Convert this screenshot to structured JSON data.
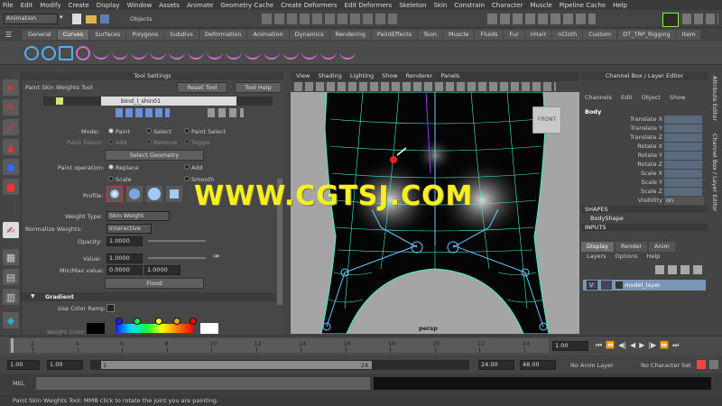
{
  "menu": [
    "File",
    "Edit",
    "Modify",
    "Create",
    "Display",
    "Window",
    "Assets",
    "Animate",
    "Geometry Cache",
    "Create Deformers",
    "Edit Deformers",
    "Skeleton",
    "Skin",
    "Constrain",
    "Character",
    "Muscle",
    "Pipeline Cache",
    "Help"
  ],
  "status_line": {
    "mode": "Animation",
    "objects_label": "Objects"
  },
  "shelf_tabs": [
    "General",
    "Curves",
    "Surfaces",
    "Polygons",
    "Subdivs",
    "Deformation",
    "Animation",
    "Dynamics",
    "Rendering",
    "PaintEffects",
    "Toon",
    "Muscle",
    "Fluids",
    "Fur",
    "nHair",
    "nCloth",
    "Custom",
    "DT_TRP_Rigging",
    "Item"
  ],
  "shelf_active_tab": "Curves",
  "tool_settings": {
    "title": "Tool Settings",
    "tool_name": "Paint Skin Weights Tool",
    "reset_label": "Reset Tool",
    "help_label": "Tool Help",
    "influence": "bind_l_shin01",
    "mode_label": "Mode:",
    "mode_options": [
      "Paint",
      "Select",
      "Paint Select"
    ],
    "paint_select_label": "Paint Select:",
    "paint_select_options": [
      "Add",
      "Remove",
      "Toggle"
    ],
    "select_geometry": "Select Geometry",
    "paint_operation_label": "Paint operation:",
    "paint_ops": [
      "Replace",
      "Add",
      "Scale",
      "Smooth"
    ],
    "profile_label": "Profile:",
    "weight_type_label": "Weight Type:",
    "weight_type": "Skin Weight",
    "normalize_label": "Normalize Weights:",
    "normalize": "Interactive",
    "opacity_label": "Opacity:",
    "opacity": "1.0000",
    "value_label": "Value:",
    "value": "1.0000",
    "minmax_label": "Min/Max value:",
    "min": "0.0000",
    "max": "1.0000",
    "flood": "Flood",
    "gradient_label": "Gradient",
    "color_ramp_label": "Use Color Ramp",
    "weight_color_label": "Weight Color:"
  },
  "viewport": {
    "menu": [
      "View",
      "Shading",
      "Lighting",
      "Show",
      "Renderer",
      "Panels"
    ],
    "cube_label": "FRONT",
    "camera": "persp",
    "watermark": "WWW.CGTSJ.COM"
  },
  "channel_box": {
    "title": "Channel Box / Layer Editor",
    "menu": [
      "Channels",
      "Edit",
      "Object",
      "Show"
    ],
    "object": "Body",
    "attrs": [
      "Translate X",
      "Translate Y",
      "Translate Z",
      "Rotate X",
      "Rotate Y",
      "Rotate Z",
      "Scale X",
      "Scale Y",
      "Scale Z",
      "Visibility"
    ],
    "visibility_value": "on",
    "shapes_label": "SHAPES",
    "shape": "BodyShape",
    "inputs_label": "INPUTS",
    "layer_tabs": [
      "Display",
      "Render",
      "Anim"
    ],
    "layer_menu": [
      "Layers",
      "Options",
      "Help"
    ],
    "layer_name": "model_layer",
    "layer_vis": "V",
    "side_tabs": [
      "Attribute Editor",
      "Channel Box / Layer Editor"
    ]
  },
  "timeline": {
    "ticks": [
      "2",
      "4",
      "6",
      "8",
      "10",
      "12",
      "14",
      "16",
      "18",
      "20",
      "22",
      "24"
    ],
    "current": "1.00"
  },
  "range": {
    "start": "1.00",
    "inner_start": "1.00",
    "slider_start": "1",
    "slider_end": "24",
    "end": "24.00",
    "outer_end": "48.00",
    "anim_layer": "No Anim Layer",
    "character": "No Character Set"
  },
  "command": {
    "label": "MEL"
  },
  "help_line": "Paint Skin Weights Tool: MMB click to rotate the joint you are painting.",
  "colors": {
    "accent": "#4ab3ff",
    "selection": "#7b97b8",
    "watermark": "#f7ef1e",
    "wire": "#3ff0d0"
  }
}
